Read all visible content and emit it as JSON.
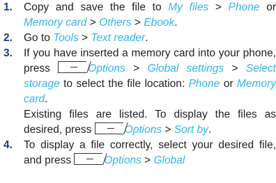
{
  "steps": [
    {
      "num": "1.",
      "parts": [
        {
          "t": "Copy and save the file to "
        },
        {
          "t": "My files",
          "l": true
        },
        {
          "t": " > "
        },
        {
          "t": "Phone",
          "l": true
        },
        {
          "t": " or "
        },
        {
          "t": "Memory card",
          "l": true
        },
        {
          "t": " > "
        },
        {
          "t": "Others",
          "l": true
        },
        {
          "t": " > "
        },
        {
          "t": "Ebook",
          "l": true
        },
        {
          "t": "."
        }
      ]
    },
    {
      "num": "2.",
      "parts": [
        {
          "t": "Go to "
        },
        {
          "t": "Tools",
          "l": true
        },
        {
          "t": " > "
        },
        {
          "t": "Text reader",
          "l": true
        },
        {
          "t": "."
        }
      ]
    },
    {
      "num": "3.",
      "parts": [
        {
          "t": "If you have inserted a memory card into your phone, press "
        },
        {
          "k": true
        },
        {
          "t": "Options",
          "l": true
        },
        {
          "t": " > "
        },
        {
          "t": "Global settings",
          "l": true
        },
        {
          "t": " > "
        },
        {
          "t": "Select storage",
          "l": true
        },
        {
          "t": " to select the file location: "
        },
        {
          "t": "Phone",
          "l": true
        },
        {
          "t": " or "
        },
        {
          "t": "Memory card",
          "l": true
        },
        {
          "t": "."
        }
      ],
      "extra": [
        {
          "t": "Existing files are listed. To display the files as desired, press "
        },
        {
          "k": true
        },
        {
          "t": "Options",
          "l": true
        },
        {
          "t": " > "
        },
        {
          "t": "Sort by",
          "l": true
        },
        {
          "t": "."
        }
      ]
    },
    {
      "num": "4.",
      "parts": [
        {
          "t": "To display a file correctly, select your desired file, and press "
        },
        {
          "k": true
        },
        {
          "t": "Options",
          "l": true
        },
        {
          "t": " > "
        },
        {
          "t": "Global",
          "l": true
        }
      ]
    }
  ]
}
